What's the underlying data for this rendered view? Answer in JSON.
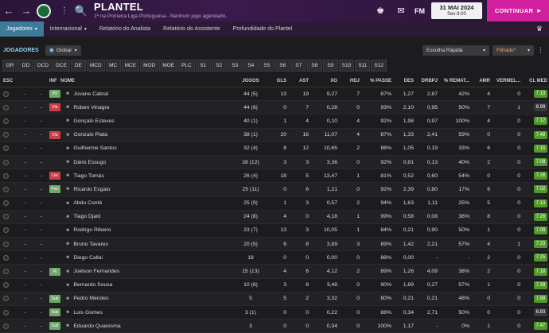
{
  "header": {
    "title": "PLANTEL",
    "subtitle": "1ª na Primeira Liga Portuguesa - Nenhum jogo agendado.",
    "fm_label": "FM",
    "date_main": "31 MAI 2024",
    "date_sub": "Sex 8:00",
    "continue_label": "CONTINUAR"
  },
  "subnav": {
    "items": [
      {
        "label": "Jogadores",
        "active": true
      },
      {
        "label": "Internacional",
        "active": false
      },
      {
        "label": "Relatório do Analista",
        "active": false
      },
      {
        "label": "Relatório do Assistente",
        "active": false
      },
      {
        "label": "Profundidade do Plantel",
        "active": false
      }
    ]
  },
  "section": {
    "label": "JOGADORES",
    "global_filter": "Global",
    "quick_pick": "Escolha Rápida",
    "filtered": "Filtrado*"
  },
  "position_tabs": [
    "GR",
    "DD",
    "DCD",
    "DCE",
    "DE",
    "MCD",
    "MC",
    "MCE",
    "MOD",
    "MOE",
    "PLC",
    "S1",
    "S2",
    "S3",
    "S4",
    "S5",
    "S6",
    "S7",
    "S8",
    "S9",
    "S10",
    "S11",
    "S12"
  ],
  "columns": {
    "esc": "ESC",
    "inf": "INF",
    "nome": "NOME",
    "jogos": "JOGOS",
    "gls": "GLS",
    "ast": "AST",
    "xg": "XG",
    "hdj": "HDJ",
    "passe": "% PASSE",
    "des": "DES",
    "drbpj": "DRBPJ",
    "remat": "% REMAT...",
    "amr": "AMR",
    "verm": "VERMEL...",
    "clmed": "CL MED"
  },
  "colors": {
    "badge_green": "#6fa86a",
    "badge_red": "#c7404a",
    "rating_green": "#4f9a2b",
    "rating_gray": "#3a3a3e"
  },
  "rows": [
    {
      "esc": "-",
      "inf": "-",
      "badge": "Prt",
      "badge_color": "green",
      "name": "Jovane Cabral",
      "jogos": "44 (5)",
      "gls": "13",
      "ast": "19",
      "xg": "9,27",
      "hdj": "7",
      "passe": "87%",
      "des": "1,27",
      "drbpj": "2,87",
      "remat": "42%",
      "amr": "4",
      "verm": "0",
      "clmed": "7.13",
      "rating_color": "green"
    },
    {
      "esc": "-",
      "inf": "-",
      "badge": "Via",
      "badge_color": "red",
      "name": "Rúben Vinagre",
      "jogos": "44 (6)",
      "gls": "0",
      "ast": "7",
      "xg": "0,28",
      "hdj": "0",
      "passe": "93%",
      "des": "2,10",
      "drbpj": "0,95",
      "remat": "50%",
      "amr": "7",
      "verm": "1",
      "clmed": "6.99",
      "rating_color": "gray"
    },
    {
      "esc": "-",
      "inf": "-",
      "badge": "",
      "badge_color": "",
      "name": "Gonçalo Esteves",
      "jogos": "40 (1)",
      "gls": "1",
      "ast": "4",
      "xg": "0,10",
      "hdj": "4",
      "passe": "92%",
      "des": "1,98",
      "drbpj": "0,97",
      "remat": "100%",
      "amr": "4",
      "verm": "0",
      "clmed": "7.12",
      "rating_color": "green"
    },
    {
      "esc": "-",
      "inf": "-",
      "badge": "Via",
      "badge_color": "red",
      "name": "Gonzalo Plata",
      "jogos": "38 (1)",
      "gls": "20",
      "ast": "16",
      "xg": "11,07",
      "hdj": "4",
      "passe": "87%",
      "des": "1,33",
      "drbpj": "2,41",
      "remat": "59%",
      "amr": "0",
      "verm": "0",
      "clmed": "7.48",
      "rating_color": "green"
    },
    {
      "esc": "-",
      "inf": "-",
      "badge": "",
      "badge_color": "",
      "name": "Guilherme Santos",
      "jogos": "32 (4)",
      "gls": "8",
      "ast": "12",
      "xg": "10,65",
      "hdj": "2",
      "passe": "88%",
      "des": "1,05",
      "drbpj": "0,19",
      "remat": "33%",
      "amr": "6",
      "verm": "0",
      "clmed": "7.15",
      "rating_color": "green"
    },
    {
      "esc": "-",
      "inf": "-",
      "badge": "",
      "badge_color": "",
      "name": "Dário Essugo",
      "jogos": "28 (12)",
      "gls": "3",
      "ast": "3",
      "xg": "3,36",
      "hdj": "0",
      "passe": "92%",
      "des": "0,81",
      "drbpj": "0,13",
      "remat": "40%",
      "amr": "2",
      "verm": "0",
      "clmed": "7.08",
      "rating_color": "green"
    },
    {
      "esc": "-",
      "inf": "-",
      "badge": "Les",
      "badge_color": "red",
      "name": "Tiago Tomás",
      "jogos": "26 (4)",
      "gls": "18",
      "ast": "5",
      "xg": "13,47",
      "hdj": "1",
      "passe": "81%",
      "des": "0,52",
      "drbpj": "0,60",
      "remat": "54%",
      "amr": "0",
      "verm": "0",
      "clmed": "7.26",
      "rating_color": "green"
    },
    {
      "esc": "-",
      "inf": "-",
      "badge": "Prm",
      "badge_color": "green",
      "name": "Ricardo Esgaio",
      "jogos": "25 (11)",
      "gls": "0",
      "ast": "6",
      "xg": "1,21",
      "hdj": "0",
      "passe": "92%",
      "des": "2,39",
      "drbpj": "0,80",
      "remat": "17%",
      "amr": "6",
      "verm": "0",
      "clmed": "7.02",
      "rating_color": "green"
    },
    {
      "esc": "-",
      "inf": "-",
      "badge": "",
      "badge_color": "",
      "name": "Abdu Conté",
      "jogos": "25 (9)",
      "gls": "1",
      "ast": "3",
      "xg": "0,57",
      "hdj": "2",
      "passe": "94%",
      "des": "1,63",
      "drbpj": "1,11",
      "remat": "25%",
      "amr": "5",
      "verm": "0",
      "clmed": "7.13",
      "rating_color": "green"
    },
    {
      "esc": "-",
      "inf": "-",
      "badge": "",
      "badge_color": "",
      "name": "Tiago Djaló",
      "jogos": "24 (8)",
      "gls": "4",
      "ast": "0",
      "xg": "4,18",
      "hdj": "1",
      "passe": "99%",
      "des": "0,58",
      "drbpj": "0,08",
      "remat": "36%",
      "amr": "8",
      "verm": "0",
      "clmed": "7.26",
      "rating_color": "green"
    },
    {
      "esc": "-",
      "inf": "-",
      "badge": "",
      "badge_color": "",
      "name": "Rodrigo Ribeiro",
      "jogos": "23 (7)",
      "gls": "13",
      "ast": "3",
      "xg": "10,05",
      "hdj": "1",
      "passe": "84%",
      "des": "0,21",
      "drbpj": "0,90",
      "remat": "50%",
      "amr": "1",
      "verm": "0",
      "clmed": "7.09",
      "rating_color": "green"
    },
    {
      "esc": "-",
      "inf": "-",
      "badge": "",
      "badge_color": "",
      "name": "Bruno Tavares",
      "jogos": "20 (5)",
      "gls": "6",
      "ast": "8",
      "xg": "3,89",
      "hdj": "3",
      "passe": "89%",
      "des": "1,42",
      "drbpj": "2,21",
      "remat": "57%",
      "amr": "4",
      "verm": "1",
      "clmed": "7.33",
      "rating_color": "green"
    },
    {
      "esc": "-",
      "inf": "-",
      "badge": "",
      "badge_color": "",
      "name": "Diego Callai",
      "jogos": "18",
      "gls": "0",
      "ast": "0",
      "xg": "0,00",
      "hdj": "0",
      "passe": "88%",
      "des": "0,00",
      "drbpj": "-",
      "remat": "-",
      "amr": "2",
      "verm": "0",
      "clmed": "7.25",
      "rating_color": "green"
    },
    {
      "esc": "-",
      "inf": "-",
      "badge": "Rj",
      "badge_color": "green",
      "name": "Joelson Fernandes",
      "jogos": "15 (13)",
      "gls": "4",
      "ast": "6",
      "xg": "4,12",
      "hdj": "2",
      "passe": "89%",
      "des": "1,26",
      "drbpj": "4,09",
      "remat": "38%",
      "amr": "2",
      "verm": "0",
      "clmed": "7.18",
      "rating_color": "green"
    },
    {
      "esc": "-",
      "inf": "-",
      "badge": "",
      "badge_color": "",
      "name": "Bernardo Sousa",
      "jogos": "10 (6)",
      "gls": "3",
      "ast": "8",
      "xg": "3,48",
      "hdj": "0",
      "passe": "90%",
      "des": "1,69",
      "drbpj": "0,27",
      "remat": "57%",
      "amr": "1",
      "verm": "0",
      "clmed": "7.39",
      "rating_color": "green"
    },
    {
      "esc": "-",
      "inf": "-",
      "badge": "Sub",
      "badge_color": "green",
      "name": "Pedro Mendes",
      "jogos": "5",
      "gls": "5",
      "ast": "2",
      "xg": "3,32",
      "hdj": "0",
      "passe": "80%",
      "des": "0,21",
      "drbpj": "0,21",
      "remat": "48%",
      "amr": "0",
      "verm": "0",
      "clmed": "7.88",
      "rating_color": "green"
    },
    {
      "esc": "-",
      "inf": "-",
      "badge": "Sub",
      "badge_color": "green",
      "name": "Luís Gomes",
      "jogos": "3 (1)",
      "gls": "0",
      "ast": "0",
      "xg": "0,22",
      "hdj": "0",
      "passe": "88%",
      "des": "0,34",
      "drbpj": "2,71",
      "remat": "50%",
      "amr": "0",
      "verm": "0",
      "clmed": "6.83",
      "rating_color": "gray"
    },
    {
      "esc": "-",
      "inf": "-",
      "badge": "Sub",
      "badge_color": "green",
      "name": "Eduardo Quaresma",
      "jogos": "3",
      "gls": "0",
      "ast": "0",
      "xg": "0,34",
      "hdj": "0",
      "passe": "100%",
      "des": "1,17",
      "drbpj": "-",
      "remat": "0%",
      "amr": "1",
      "verm": "0",
      "clmed": "7.47",
      "rating_color": "green"
    }
  ]
}
